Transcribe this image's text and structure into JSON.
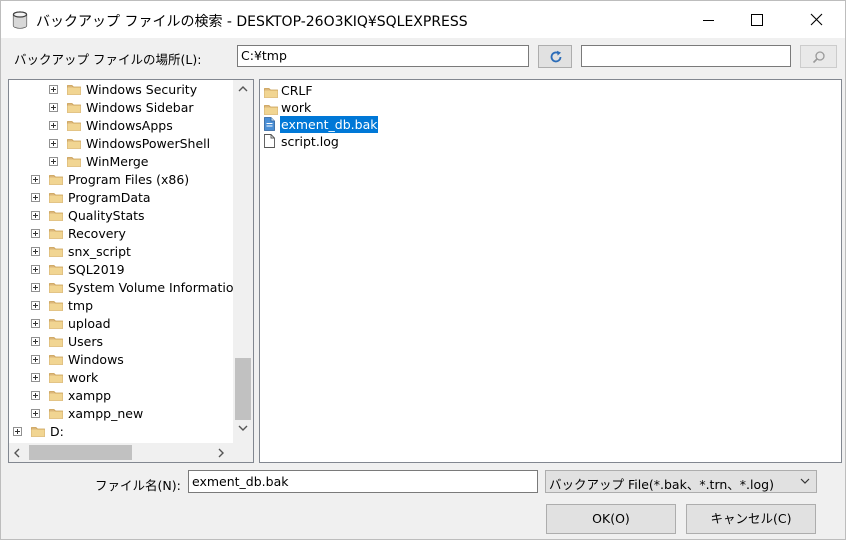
{
  "window": {
    "title": "バックアップ ファイルの検索 - DESKTOP-26O3KIQ¥SQLEXPRESS"
  },
  "location": {
    "label": "バックアップ ファイルの場所(L):",
    "path": "C:¥tmp",
    "search_value": ""
  },
  "tree": {
    "items": [
      {
        "label": "Windows Security",
        "depth": 2
      },
      {
        "label": "Windows Sidebar",
        "depth": 2
      },
      {
        "label": "WindowsApps",
        "depth": 2
      },
      {
        "label": "WindowsPowerShell",
        "depth": 2
      },
      {
        "label": "WinMerge",
        "depth": 2
      },
      {
        "label": "Program Files (x86)",
        "depth": 1
      },
      {
        "label": "ProgramData",
        "depth": 1
      },
      {
        "label": "QualityStats",
        "depth": 1
      },
      {
        "label": "Recovery",
        "depth": 1
      },
      {
        "label": "snx_script",
        "depth": 1
      },
      {
        "label": "SQL2019",
        "depth": 1
      },
      {
        "label": "System Volume Informatio",
        "depth": 1
      },
      {
        "label": "tmp",
        "depth": 1
      },
      {
        "label": "upload",
        "depth": 1
      },
      {
        "label": "Users",
        "depth": 1
      },
      {
        "label": "Windows",
        "depth": 1
      },
      {
        "label": "work",
        "depth": 1
      },
      {
        "label": "xampp",
        "depth": 1
      },
      {
        "label": "xampp_new",
        "depth": 1
      },
      {
        "label": "D:",
        "depth": 0
      }
    ]
  },
  "files": {
    "items": [
      {
        "name": "CRLF",
        "type": "folder"
      },
      {
        "name": "work",
        "type": "folder"
      },
      {
        "name": "exment_db.bak",
        "type": "bak",
        "selected": true
      },
      {
        "name": "script.log",
        "type": "file"
      }
    ]
  },
  "filename": {
    "label": "ファイル名(N):",
    "value": "exment_db.bak"
  },
  "filetype": {
    "selected": "バックアップ File(*.bak、*.trn、*.log)"
  },
  "buttons": {
    "ok": "OK(O)",
    "cancel": "キャンセル(C)"
  },
  "colors": {
    "selection": "#0078d7",
    "folder": "#dcb67a",
    "refresh_icon": "#2b6cb8"
  }
}
